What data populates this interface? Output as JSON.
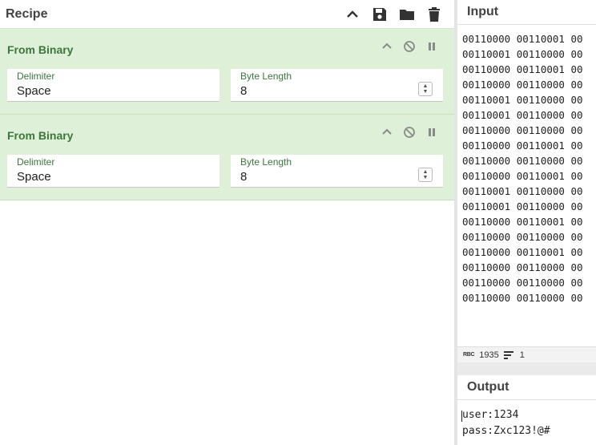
{
  "recipe": {
    "title": "Recipe",
    "tools": [
      "chevron-up-icon",
      "save-icon",
      "folder-icon",
      "trash-icon"
    ],
    "operations": [
      {
        "name": "From Binary",
        "delimiter_label": "Delimiter",
        "delimiter_value": "Space",
        "byte_length_label": "Byte Length",
        "byte_length_value": "8"
      },
      {
        "name": "From Binary",
        "delimiter_label": "Delimiter",
        "delimiter_value": "Space",
        "byte_length_label": "Byte Length",
        "byte_length_value": "8"
      }
    ]
  },
  "input": {
    "title": "Input",
    "lines": [
      "00110000 00110001 00",
      "00110001 00110000 00",
      "00110000 00110001 00",
      "00110000 00110000 00",
      "00110001 00110000 00",
      "00110001 00110000 00",
      "00110000 00110000 00",
      "00110000 00110001 00",
      "00110000 00110000 00",
      "00110000 00110001 00",
      "00110001 00110000 00",
      "00110001 00110000 00",
      "00110000 00110001 00",
      "00110000 00110000 00",
      "00110000 00110001 00",
      "00110000 00110000 00",
      "00110000 00110000 00",
      "00110000 00110000 00"
    ],
    "char_count": "1935",
    "line_count": "1",
    "status_icon_label": "RBC"
  },
  "output": {
    "title": "Output",
    "lines": [
      "user:1234",
      "pass:Zxc123!@#"
    ]
  },
  "colors": {
    "op_bg": "#dff0d8",
    "op_text": "#3c763d"
  }
}
